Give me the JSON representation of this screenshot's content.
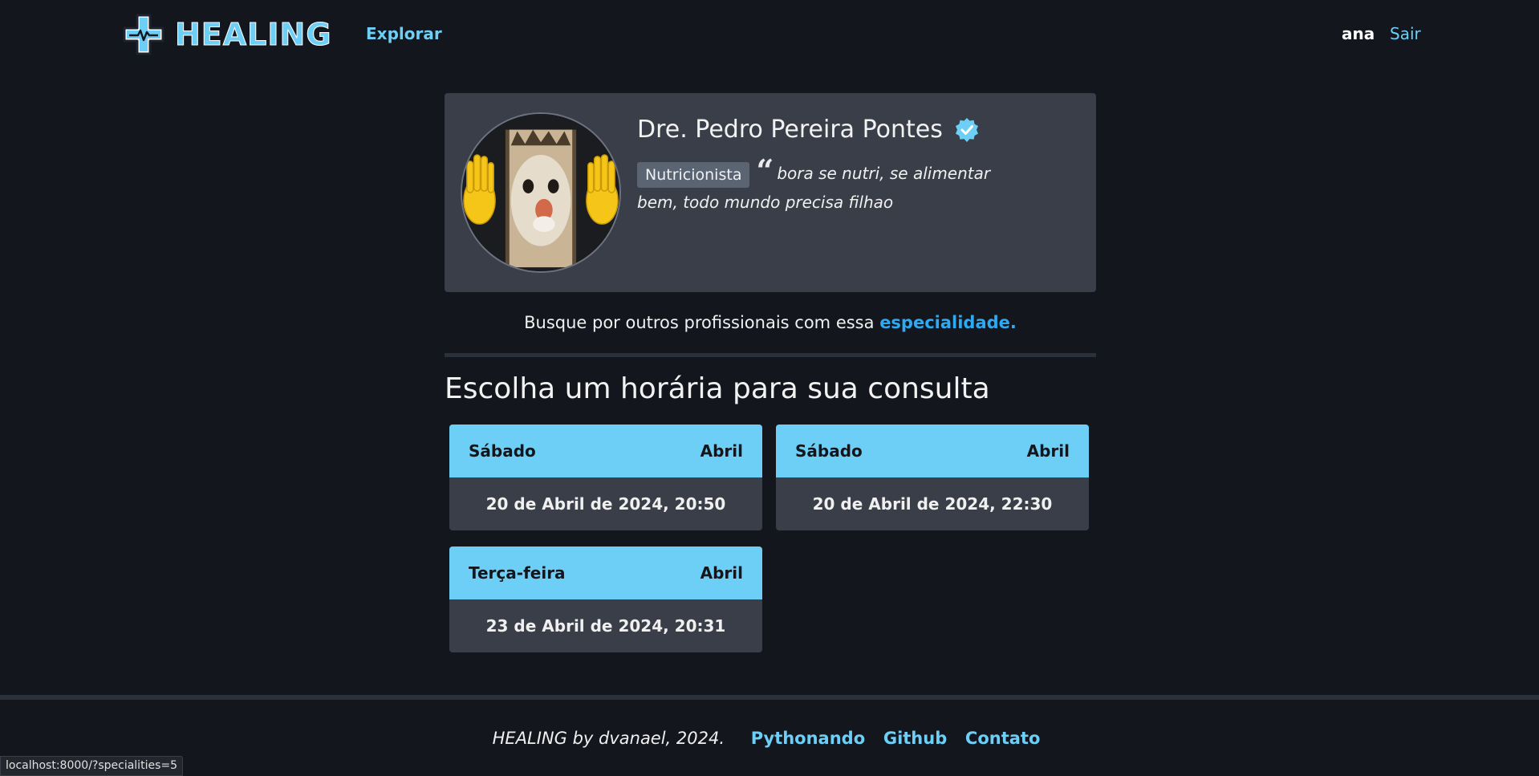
{
  "brand": {
    "name": "HEALING",
    "accent": "#6dcff6"
  },
  "nav": {
    "explore": "Explorar",
    "username": "ana",
    "logout": "Sair"
  },
  "doctor": {
    "name": "Dre. Pedro Pereira Pontes",
    "verified_icon": "verified-badge-icon",
    "specialty": "Nutricionista",
    "quote_mark": "“",
    "bio": "bora se nutri, se alimentar bem, todo mundo precisa filhao"
  },
  "search": {
    "prefix": "Busque por outros profissionais com essa",
    "link": "especialidade."
  },
  "section": {
    "title": "Escolha um horária para sua consulta"
  },
  "slots": [
    {
      "weekday": "Sábado",
      "month": "Abril",
      "datetime": "20 de Abril de 2024, 20:50"
    },
    {
      "weekday": "Sábado",
      "month": "Abril",
      "datetime": "20 de Abril de 2024, 22:30"
    },
    {
      "weekday": "Terça-feira",
      "month": "Abril",
      "datetime": "23 de Abril de 2024, 20:31"
    }
  ],
  "footer": {
    "credit": "HEALING by dvanael, 2024.",
    "links": [
      "Pythonando",
      "Github",
      "Contato"
    ]
  },
  "status_bar": {
    "url": "localhost:8000/?specialities=5"
  }
}
